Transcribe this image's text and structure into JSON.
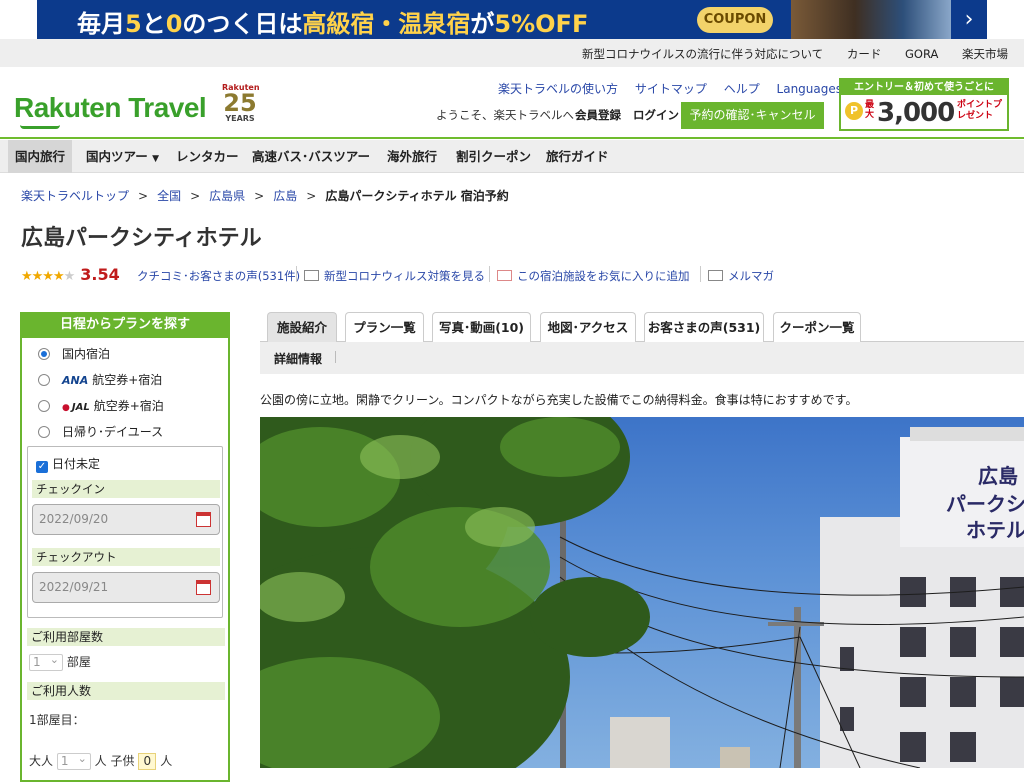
{
  "banner": {
    "text_a": "毎月",
    "text_b": "5",
    "text_c": "と",
    "text_d": "0",
    "text_e": "のつく日は",
    "text_f": "高級宿・温泉宿",
    "text_g": "が",
    "text_h": "5%OFF",
    "coupon": "COUPON"
  },
  "top_links": [
    "新型コロナウイルスの流行に伴う対応について",
    "カード",
    "GORA",
    "楽天市場"
  ],
  "header": {
    "logo": "Rakuten Travel",
    "anniv_brand": "Rakuten",
    "anniv_number": "25",
    "anniv_years": "YEARS",
    "links": [
      "楽天トラベルの使い方",
      "サイトマップ",
      "ヘルプ"
    ],
    "languages": "Languages",
    "welcome": "ようこそ、楽天トラベルへ",
    "register": "会員登録",
    "login": "ログイン",
    "reserve_button": "予約の確認･キャンセル",
    "promo_title": "エントリー＆初めて使うごとに",
    "promo_max": "最大",
    "promo_amount": "3,000",
    "promo_points": "ポイントプレゼント"
  },
  "nav": [
    "国内旅行",
    "国内ツアー",
    "レンタカー",
    "高速バス･バスツアー",
    "海外旅行",
    "割引クーポン",
    "旅行ガイド"
  ],
  "breadcrumb": [
    "楽天トラベルトップ",
    "全国",
    "広島県",
    "広島",
    "広島パークシティホテル 宿泊予約"
  ],
  "hotel": {
    "name": "広島パークシティホテル",
    "stars": 4,
    "score": "3.54",
    "reviews_link": "クチコミ･お客さまの声(531件)",
    "covid_link": "新型コロナウィルス対策を見る",
    "favorite_link": "この宿泊施設をお気に入りに追加",
    "mail_link": "メルマガ",
    "description": "公園の傍に立地。閑静でクリーン。コンパクトながら充実した設備でこの納得料金。食事は特におすすめです。"
  },
  "sidebar": {
    "title": "日程からプランを探す",
    "options": [
      "国内宿泊",
      "航空券+宿泊",
      "航空券+宿泊",
      "日帰り･デイユース"
    ],
    "ana": "ANA",
    "jal": "JAL",
    "undecided": "日付未定",
    "checkin_label": "チェックイン",
    "checkin_value": "2022/09/20",
    "checkout_label": "チェックアウト",
    "checkout_value": "2022/09/21",
    "rooms_label": "ご利用部屋数",
    "rooms_value": "1",
    "rooms_unit": "部屋",
    "guests_label": "ご利用人数",
    "room1": "1部屋目：",
    "adult_label": "大人",
    "adult_value": "1",
    "person_unit": "人",
    "child_label": "子供",
    "child_value": "0"
  },
  "tabs": [
    "施設紹介",
    "プラン一覧",
    "写真･動画(10)",
    "地図･アクセス",
    "お客さまの声(531)",
    "クーポン一覧"
  ],
  "subtab": "詳細情報",
  "photo_sign": [
    "広島",
    "パークシ",
    "ホテル"
  ],
  "colors": {
    "brand_green": "#6ab52e",
    "link": "#2a48a8",
    "score_red": "#c01b1b",
    "star": "#f0a800"
  }
}
